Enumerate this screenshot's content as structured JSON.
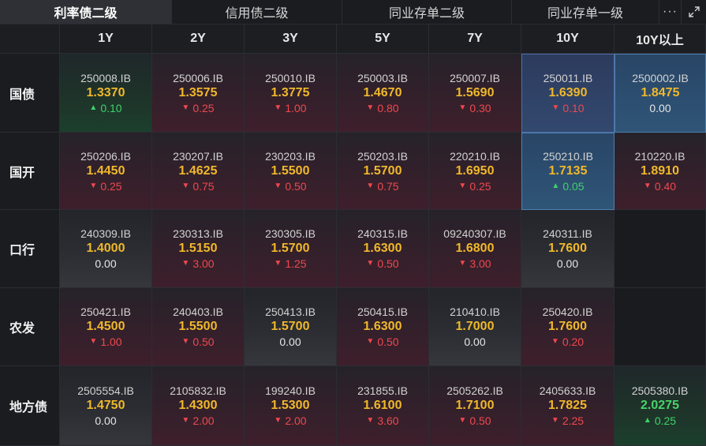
{
  "tabs": [
    {
      "label": "利率债二级",
      "active": true,
      "width": 218
    },
    {
      "label": "信用债二级",
      "active": false,
      "width": 216
    },
    {
      "label": "同业存单二级",
      "active": false,
      "width": 215
    },
    {
      "label": "同业存单一级",
      "active": false,
      "width": 187
    }
  ],
  "tab_more_label": "···",
  "columns": [
    "1Y",
    "2Y",
    "3Y",
    "5Y",
    "7Y",
    "10Y",
    "10Y以上"
  ],
  "rows": [
    {
      "label": "国债",
      "cells": [
        {
          "code": "250008.IB",
          "yield": "1.3370",
          "change": "0.10",
          "dir": "up",
          "style": "up"
        },
        {
          "code": "250006.IB",
          "yield": "1.3575",
          "change": "0.25",
          "dir": "down",
          "style": "down"
        },
        {
          "code": "250010.IB",
          "yield": "1.3775",
          "change": "1.00",
          "dir": "down",
          "style": "down"
        },
        {
          "code": "250003.IB",
          "yield": "1.4670",
          "change": "0.80",
          "dir": "down",
          "style": "down"
        },
        {
          "code": "250007.IB",
          "yield": "1.5690",
          "change": "0.30",
          "dir": "down",
          "style": "down"
        },
        {
          "code": "250011.IB",
          "yield": "1.6390",
          "change": "0.10",
          "dir": "down",
          "style": "sel-blue"
        },
        {
          "code": "2500002.IB",
          "yield": "1.8475",
          "change": "0.00",
          "dir": "flat",
          "style": "sel-teal"
        }
      ]
    },
    {
      "label": "国开",
      "cells": [
        {
          "code": "250206.IB",
          "yield": "1.4450",
          "change": "0.25",
          "dir": "down",
          "style": "down"
        },
        {
          "code": "230207.IB",
          "yield": "1.4625",
          "change": "0.75",
          "dir": "down",
          "style": "down"
        },
        {
          "code": "230203.IB",
          "yield": "1.5500",
          "change": "0.50",
          "dir": "down",
          "style": "down"
        },
        {
          "code": "250203.IB",
          "yield": "1.5700",
          "change": "0.75",
          "dir": "down",
          "style": "down"
        },
        {
          "code": "220210.IB",
          "yield": "1.6950",
          "change": "0.25",
          "dir": "down",
          "style": "down"
        },
        {
          "code": "250210.IB",
          "yield": "1.7135",
          "change": "0.05",
          "dir": "up",
          "style": "sel-teal"
        },
        {
          "code": "210220.IB",
          "yield": "1.8910",
          "change": "0.40",
          "dir": "down",
          "style": "down"
        }
      ]
    },
    {
      "label": "口行",
      "cells": [
        {
          "code": "240309.IB",
          "yield": "1.4000",
          "change": "0.00",
          "dir": "flat",
          "style": "flat"
        },
        {
          "code": "230313.IB",
          "yield": "1.5150",
          "change": "3.00",
          "dir": "down",
          "style": "down"
        },
        {
          "code": "230305.IB",
          "yield": "1.5700",
          "change": "1.25",
          "dir": "down",
          "style": "down"
        },
        {
          "code": "240315.IB",
          "yield": "1.6300",
          "change": "0.50",
          "dir": "down",
          "style": "down"
        },
        {
          "code": "09240307.IB",
          "yield": "1.6800",
          "change": "3.00",
          "dir": "down",
          "style": "down"
        },
        {
          "code": "240311.IB",
          "yield": "1.7600",
          "change": "0.00",
          "dir": "flat",
          "style": "flat"
        },
        null
      ]
    },
    {
      "label": "农发",
      "cells": [
        {
          "code": "250421.IB",
          "yield": "1.4500",
          "change": "1.00",
          "dir": "down",
          "style": "down"
        },
        {
          "code": "240403.IB",
          "yield": "1.5500",
          "change": "0.50",
          "dir": "down",
          "style": "down"
        },
        {
          "code": "250413.IB",
          "yield": "1.5700",
          "change": "0.00",
          "dir": "flat",
          "style": "flat"
        },
        {
          "code": "250415.IB",
          "yield": "1.6300",
          "change": "0.50",
          "dir": "down",
          "style": "down"
        },
        {
          "code": "210410.IB",
          "yield": "1.7000",
          "change": "0.00",
          "dir": "flat",
          "style": "flat"
        },
        {
          "code": "250420.IB",
          "yield": "1.7600",
          "change": "0.20",
          "dir": "down",
          "style": "down"
        },
        null
      ]
    },
    {
      "label": "地方债",
      "cells": [
        {
          "code": "2505554.IB",
          "yield": "1.4750",
          "change": "0.00",
          "dir": "flat",
          "style": "flat"
        },
        {
          "code": "2105832.IB",
          "yield": "1.4300",
          "change": "2.00",
          "dir": "down",
          "style": "down"
        },
        {
          "code": "199240.IB",
          "yield": "1.5300",
          "change": "2.00",
          "dir": "down",
          "style": "down"
        },
        {
          "code": "231855.IB",
          "yield": "1.6100",
          "change": "3.60",
          "dir": "down",
          "style": "down"
        },
        {
          "code": "2505262.IB",
          "yield": "1.7100",
          "change": "0.50",
          "dir": "down",
          "style": "down"
        },
        {
          "code": "2405633.IB",
          "yield": "1.7825",
          "change": "2.25",
          "dir": "down",
          "style": "down"
        },
        {
          "code": "2505380.IB",
          "yield": "2.0275",
          "change": "0.25",
          "dir": "up",
          "style": "up",
          "yield_color": "green"
        }
      ]
    }
  ]
}
